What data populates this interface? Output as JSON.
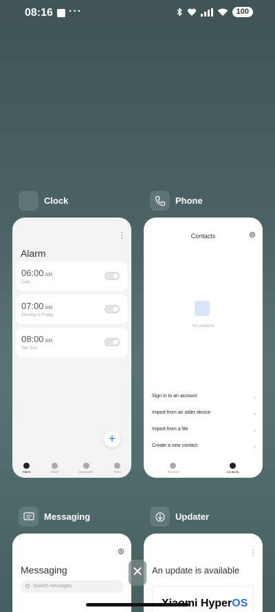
{
  "status_bar": {
    "time": "08:16",
    "dots": "···",
    "battery": "100"
  },
  "apps": {
    "clock": {
      "label": "Clock",
      "screen": {
        "title": "Alarm",
        "alarms": [
          {
            "time": "06:00",
            "ampm": "AM",
            "sub": "Daily"
          },
          {
            "time": "07:00",
            "ampm": "AM",
            "sub": "Monday to Friday"
          },
          {
            "time": "08:00",
            "ampm": "AM",
            "sub": "Sat, Sun"
          }
        ],
        "tabs": [
          "Alarm",
          "Clock",
          "Stopwatch",
          "Timer"
        ]
      }
    },
    "phone": {
      "label": "Phone",
      "screen": {
        "title": "Contacts",
        "empty_text": "No contacts",
        "menu": [
          "Sign in to an account",
          "Import from an older device",
          "Import from a file",
          "Create a new contact"
        ],
        "tabs": [
          "Recents",
          "Contacts"
        ]
      }
    },
    "messaging": {
      "label": "Messaging",
      "screen": {
        "title": "Messaging",
        "search_placeholder": "Search messages"
      }
    },
    "updater": {
      "label": "Updater",
      "screen": {
        "title": "An update is available"
      }
    }
  },
  "close_label": "✕",
  "brand": {
    "name": "Xiaomi Hyper",
    "os": "OS"
  }
}
